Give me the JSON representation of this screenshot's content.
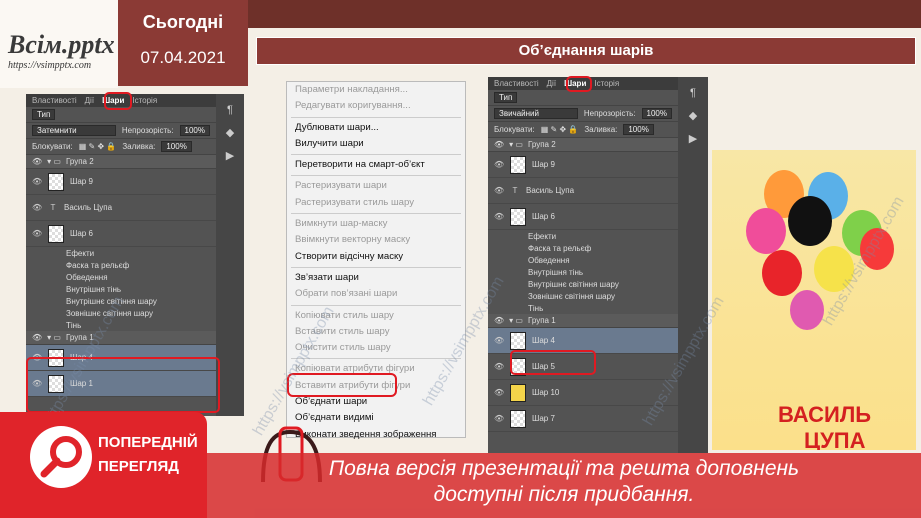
{
  "header": {
    "logo": "Всім.pptx",
    "logo_url": "https://vsimpptx.com",
    "today_label": "Сьогодні",
    "date": "07.04.2021",
    "slide_title": "Об’єднання шарів"
  },
  "left_panel": {
    "tabs": [
      "Властивості",
      "Дії",
      "Шари",
      "Історія"
    ],
    "kind": "Тип",
    "blend_mode": "Затемнити",
    "opacity_label": "Непрозорість:",
    "opacity_value": "100%",
    "lock_label": "Блокувати:",
    "fill_label": "Заливка:",
    "fill_value": "100%",
    "group2": "Група 2",
    "layers": [
      "Шар 9",
      "Василь Цупа",
      "Шар 6"
    ],
    "effects_label": "Ефекти",
    "effects": [
      "Фаска та рельєф",
      "Обведення",
      "Внутрішня тінь",
      "Внутрішнє світіння шару",
      "Зовнішнє світіння шару",
      "Тінь"
    ],
    "group1": "Група 1",
    "selected_layers": [
      "Шар 4",
      "Шар 1"
    ]
  },
  "menu": {
    "items": [
      {
        "label": "Параметри накладання...",
        "disabled": true
      },
      {
        "label": "Редагувати коригування...",
        "disabled": true
      },
      {
        "label": "Дублювати шари...",
        "disabled": false
      },
      {
        "label": "Вилучити шари",
        "disabled": false
      },
      {
        "label": "Перетворити на смарт-об’єкт",
        "disabled": false
      },
      {
        "label": "Растеризувати шари",
        "disabled": true
      },
      {
        "label": "Растеризувати стиль шару",
        "disabled": true
      },
      {
        "label": "Вимкнути шар-маску",
        "disabled": true
      },
      {
        "label": "Ввімкнути векторну маску",
        "disabled": true
      },
      {
        "label": "Створити відсічну маску",
        "disabled": false
      },
      {
        "label": "Зв’язати шари",
        "disabled": false
      },
      {
        "label": "Обрати пов’язані шари",
        "disabled": true
      },
      {
        "label": "Копіювати стиль шару",
        "disabled": true
      },
      {
        "label": "Вставити стиль шару",
        "disabled": true
      },
      {
        "label": "Очистити стиль шару",
        "disabled": true
      },
      {
        "label": "Копіювати атрибути фігури",
        "disabled": true
      },
      {
        "label": "Вставити атрибути фігури",
        "disabled": true
      },
      {
        "label": "Об’єднати шари",
        "disabled": false
      },
      {
        "label": "Об’єднати видимі",
        "disabled": false
      },
      {
        "label": "Виконати зведення зображення",
        "disabled": false
      }
    ]
  },
  "right_panel": {
    "tabs": [
      "Властивості",
      "Дії",
      "Шари",
      "Історія"
    ],
    "kind": "Тип",
    "blend_mode": "Звичайний",
    "opacity_label": "Непрозорість:",
    "opacity_value": "100%",
    "lock_label": "Блокувати:",
    "fill_label": "Заливка:",
    "fill_value": "100%",
    "group2": "Група 2",
    "layers": [
      "Шар 9",
      "Василь Цупа",
      "Шар 6"
    ],
    "effects_label": "Ефекти",
    "effects": [
      "Фаска та рельєф",
      "Обведення",
      "Внутрішня тінь",
      "Внутрішнє світіння шару",
      "Зовнішнє світіння шару",
      "Тінь"
    ],
    "group1": "Група 1",
    "group1_layers": [
      "Шар 4",
      "Шар 5",
      "Шар 10"
    ],
    "bottom_layer": "Шар 7"
  },
  "picture": {
    "text1": "ВАСИЛЬ",
    "text2": "ЦУПА"
  },
  "preview": {
    "line1": "ПОПЕРЕДНІЙ",
    "line2": "ПЕРЕГЛЯД"
  },
  "banner": {
    "line1": "Повна версія презентації та решта доповнень",
    "line2": "доступні після придбання."
  },
  "watermark": "https://vsimpptx.com",
  "colors": {
    "accent": "#8b3a35",
    "highlight": "#e01a22",
    "banner": "#d62a2c"
  }
}
